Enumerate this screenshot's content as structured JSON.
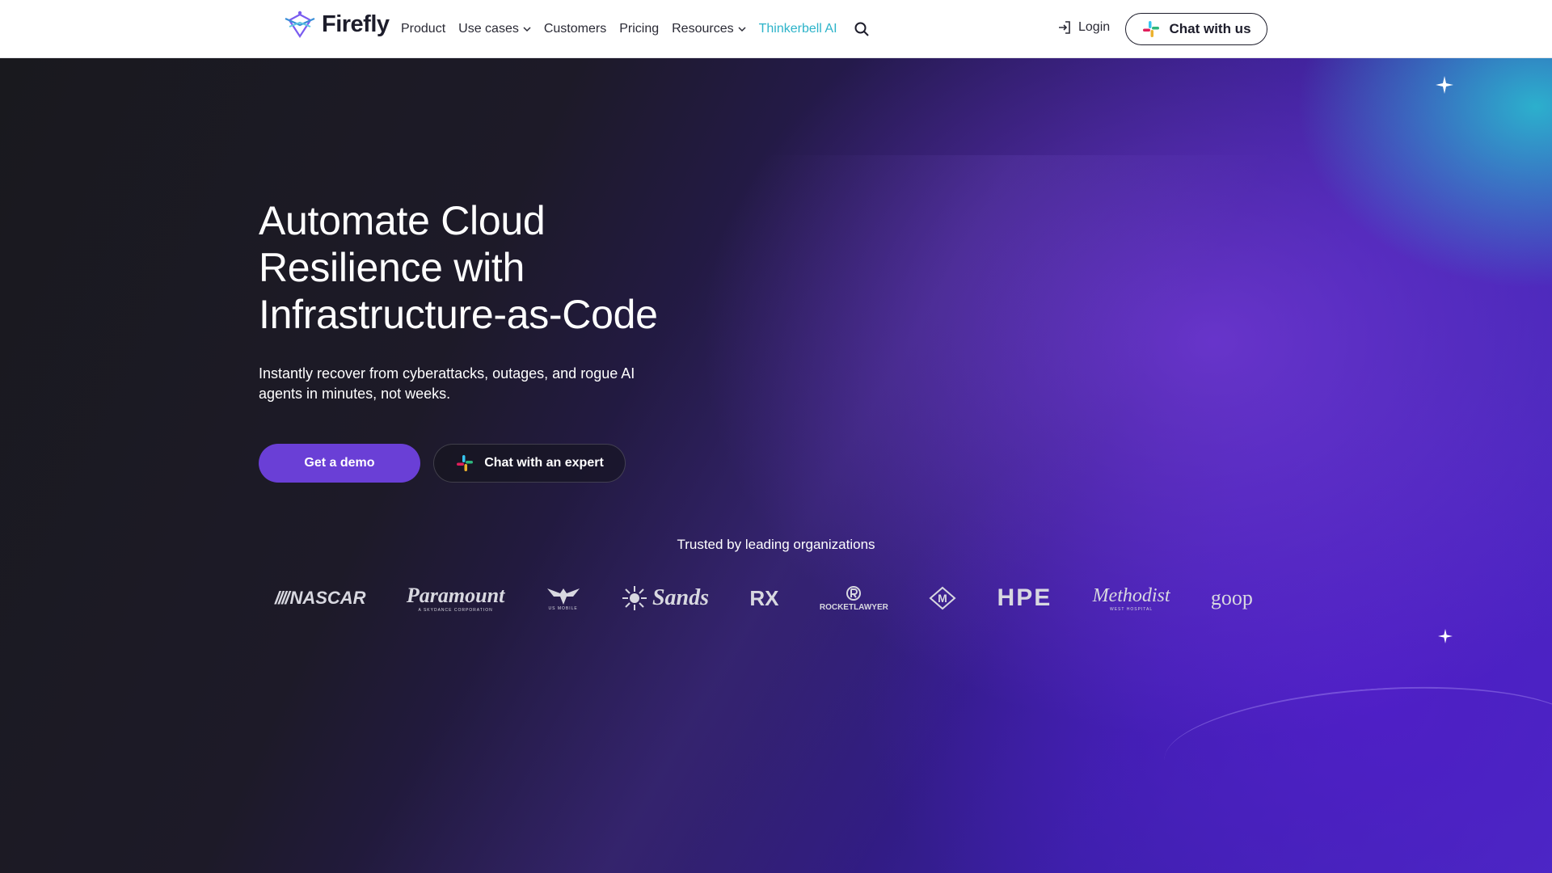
{
  "nav": {
    "logo_text": "Firefly",
    "links": [
      {
        "label": "Product"
      },
      {
        "label": "Use cases",
        "has_dropdown": true
      },
      {
        "label": "Customers"
      },
      {
        "label": "Pricing"
      },
      {
        "label": "Resources",
        "has_dropdown": true
      },
      {
        "label": "Thinkerbell AI",
        "accent": true
      }
    ],
    "search_icon": "search-icon",
    "login_label": "Login",
    "chat_label": "Chat with us"
  },
  "hero": {
    "headline_lines": [
      "Automate Cloud",
      "Resilience with",
      "Infrastructure-as-Code"
    ],
    "subhead": "Instantly recover from cyberattacks, outages, and rogue AI agents in minutes, not weeks.",
    "primary_cta": "Get a demo",
    "secondary_cta": "Chat with an expert"
  },
  "trusted": {
    "label": "Trusted by leading organizations",
    "brands": [
      {
        "name": "NASCAR"
      },
      {
        "name": "Paramount",
        "tagline": "A SKYDANCE CORPORATION"
      },
      {
        "name": "US Mobile",
        "tagline": "US MOBILE"
      },
      {
        "name": "Sands"
      },
      {
        "name": "RX"
      },
      {
        "name": "ROCKETLAWYER"
      },
      {
        "name": "M"
      },
      {
        "name": "HPE"
      },
      {
        "name": "Methodist",
        "tagline": "WEST HOSPITAL"
      },
      {
        "name": "goop"
      }
    ]
  },
  "colors": {
    "accent_purple": "#6a3fd6",
    "link_teal": "#2cb3c9",
    "nav_bg": "#ffffff",
    "hero_dark": "#19191e"
  }
}
